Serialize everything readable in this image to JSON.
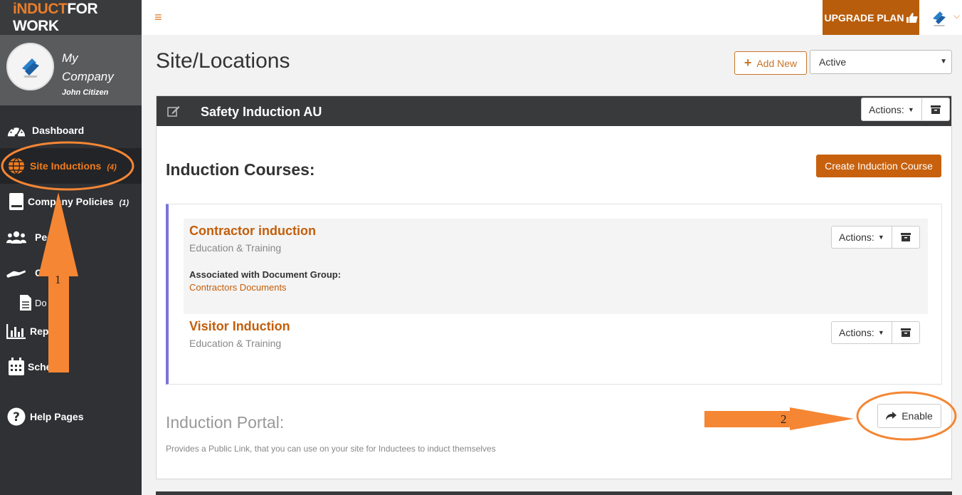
{
  "brand": {
    "logo_part1": "iNDUCT",
    "logo_part2": "FOR WORK"
  },
  "profile": {
    "company": "My Company",
    "user": "John Citizen"
  },
  "sidebar": {
    "items": [
      {
        "label": "Dashboard",
        "count": "",
        "icon": "dashboard-icon"
      },
      {
        "label": "Site Inductions",
        "count": "(4)",
        "icon": "globe-icon"
      },
      {
        "label": "Company Policies",
        "count": "(1)",
        "icon": "book-icon"
      },
      {
        "label": "Peo",
        "count": "",
        "icon": "people-icon"
      },
      {
        "label": "C",
        "count": "",
        "icon": "hand-icon"
      },
      {
        "label": "Do      nts",
        "count": "",
        "icon": "document-icon"
      },
      {
        "label": "Rep",
        "count": "",
        "icon": "bar-chart-icon"
      },
      {
        "label": "Sche",
        "count": "",
        "icon": "calendar-icon"
      },
      {
        "label": "Help Pages",
        "count": "",
        "icon": "help-icon"
      }
    ]
  },
  "topbar": {
    "menu_icon": "≡",
    "upgrade_label": "UPGRADE PLAN"
  },
  "page": {
    "title": "Site/Locations",
    "add_new_label": "Add New",
    "status_value": "Active"
  },
  "site": {
    "name": "Safety Induction AU",
    "actions_label": "Actions:",
    "courses_heading": "Induction Courses:",
    "create_course_label": "Create Induction Course",
    "courses": [
      {
        "name": "Contractor induction",
        "category": "Education & Training",
        "assoc_label": "Associated with Document Group:",
        "assoc_link": "Contractors Documents",
        "actions_label": "Actions:"
      },
      {
        "name": "Visitor Induction",
        "category": "Education & Training",
        "actions_label": "Actions:"
      }
    ],
    "portal_heading": "Induction Portal:",
    "portal_desc": "Provides a Public Link, that you can use on your site for Inductees to induct themselves",
    "enable_label": "Enable"
  },
  "annotations": {
    "step1": "1",
    "step2": "2"
  },
  "colors": {
    "accent": "#c8610e",
    "sidebar": "#2f3134",
    "annotation": "#f58634"
  }
}
